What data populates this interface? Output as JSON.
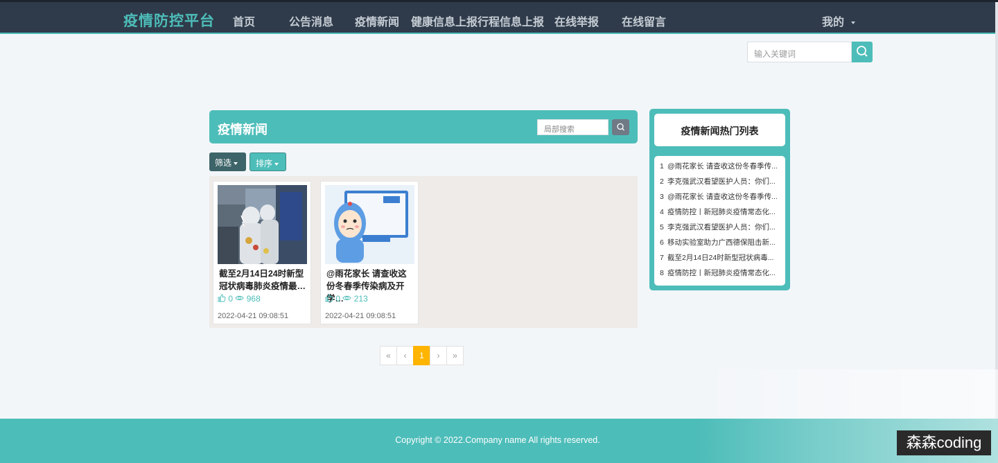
{
  "app": {
    "brand": "疫情防控平台",
    "nav": [
      "首页",
      "公告消息",
      "疫情新闻",
      "健康信息上报",
      "行程信息上报",
      "在线举报",
      "在线留言"
    ],
    "user_menu": "我的"
  },
  "global_search": {
    "placeholder": "输入关键词"
  },
  "main": {
    "title": "疫情新闻",
    "local_search_placeholder": "局部搜索",
    "filter_label": "筛选",
    "sort_label": "排序",
    "cards": [
      {
        "title": "截至2月14日24时新型冠状病毒肺炎疫情最…",
        "likes": "0",
        "views": "968",
        "date": "2022-04-21 09:08:51"
      },
      {
        "title": "@雨花家长 请查收这份冬春季传染病及开学…",
        "likes": "0",
        "views": "213",
        "date": "2022-04-21 09:08:51"
      }
    ]
  },
  "pagination": {
    "first": "«",
    "prev": "‹",
    "current": "1",
    "next": "›",
    "last": "»"
  },
  "sidebar": {
    "title": "疫情新闻热门列表",
    "items": [
      {
        "num": "1",
        "text": "@雨花家长 请查收这份冬春季传..."
      },
      {
        "num": "2",
        "text": "李克强武汉看望医护人员：你们..."
      },
      {
        "num": "3",
        "text": "@雨花家长 请查收这份冬春季传..."
      },
      {
        "num": "4",
        "text": "疫情防控丨新冠肺炎疫情常态化..."
      },
      {
        "num": "5",
        "text": "李克强武汉看望医护人员：你们..."
      },
      {
        "num": "6",
        "text": "移动实验室助力广西德保阻击新..."
      },
      {
        "num": "7",
        "text": "截至2月14日24时新型冠状病毒..."
      },
      {
        "num": "8",
        "text": "疫情防控丨新冠肺炎疫情常态化..."
      }
    ]
  },
  "footer": {
    "copyright": "Copyright © 2022.Company name All rights reserved."
  },
  "watermark": "森森coding",
  "colors": {
    "accent": "#4dbdb9",
    "nav_bg": "#2f3b4a",
    "active_page": "#ffb400"
  }
}
